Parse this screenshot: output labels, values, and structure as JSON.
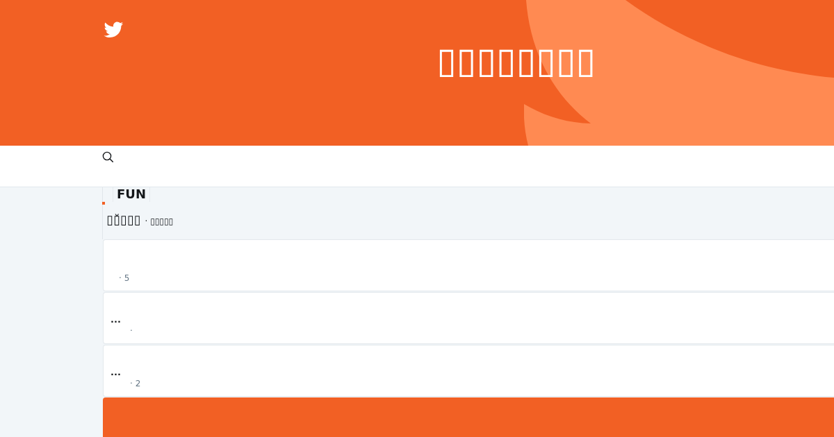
{
  "header": {
    "title": "▯▯▯▯▯▯▯▯"
  },
  "section": {
    "tag": "FUN",
    "title": "▯▯̌▯▯▯",
    "subtitle": "· ▯▯▯▯▯"
  },
  "cards": [
    {
      "meta": "· 5"
    },
    {
      "title": "...",
      "meta": "·"
    },
    {
      "title": "...",
      "meta": "· 2"
    }
  ]
}
